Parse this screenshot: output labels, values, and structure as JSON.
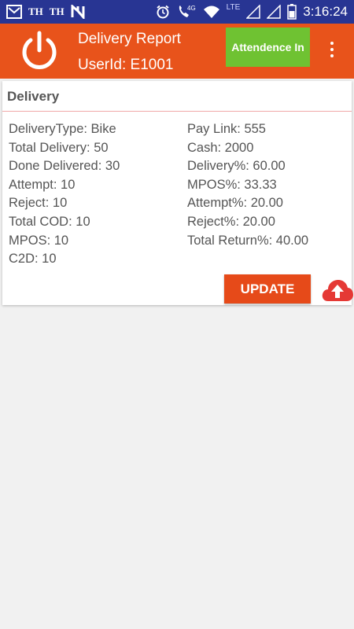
{
  "status_bar": {
    "carrier_1": "TH",
    "carrier_2": "TH",
    "network": "4G",
    "network_2": "LTE",
    "time": "3:16:24"
  },
  "app_bar": {
    "title": "Delivery Report",
    "user_id": "UserId: E1001",
    "attendance_button": "Attendence In"
  },
  "card": {
    "title": "Delivery",
    "left_rows": [
      "DeliveryType: Bike",
      "Total Delivery: 50",
      "Done Delivered: 30",
      "Attempt: 10",
      "Reject: 10",
      "Total COD: 10",
      "MPOS: 10",
      "C2D: 10"
    ],
    "right_rows": [
      "Pay Link: 555",
      "Cash: 2000",
      "Delivery%: 60.00",
      "MPOS%: 33.33",
      "Attempt%: 20.00",
      "Reject%: 20.00",
      "Total Return%: 40.00"
    ],
    "update_button": "UPDATE"
  },
  "colors": {
    "status_bar": "#283593",
    "app_bar": "#e8531b",
    "attendance_button": "#6fc232",
    "update_button": "#e64a19",
    "upload_icon": "#e53935"
  },
  "icons": [
    "mail-icon",
    "n-icon",
    "alarm-icon",
    "call-icon",
    "wifi-icon",
    "signal-icon",
    "battery-icon",
    "power-icon",
    "more-vert-icon",
    "cloud-upload-icon"
  ]
}
